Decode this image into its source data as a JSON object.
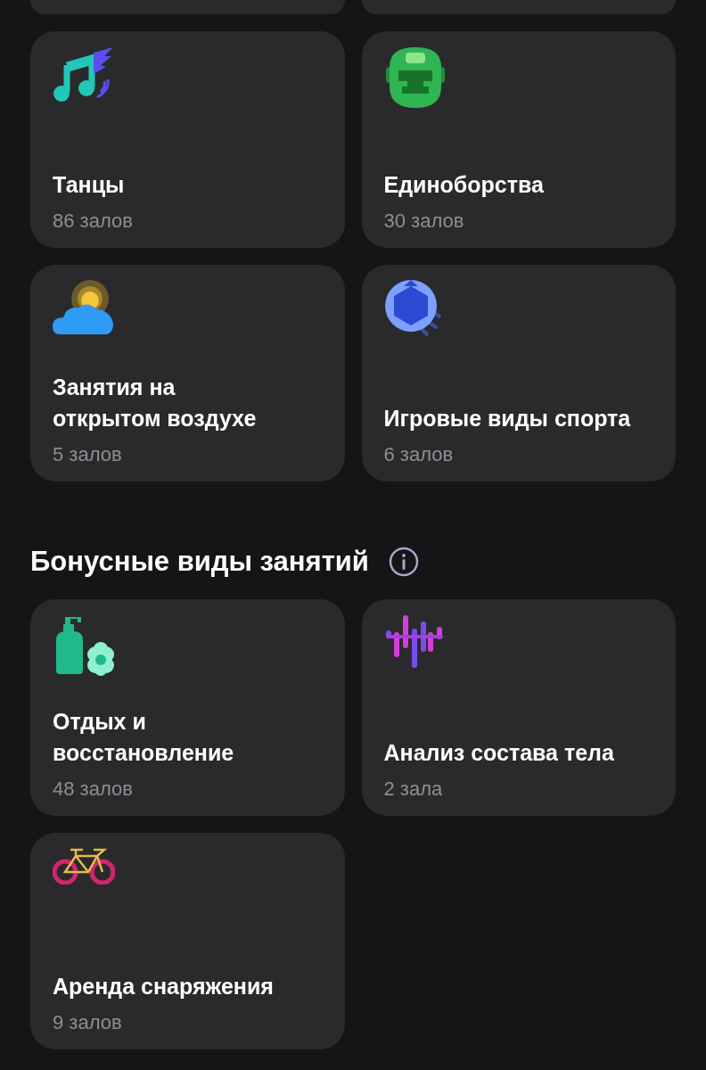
{
  "categories": [
    {
      "title": "Танцы",
      "count": "86 залов"
    },
    {
      "title": "Единоборства",
      "count": "30 залов"
    },
    {
      "title": "Занятия на\nоткрытом воздухе",
      "count": "5 залов"
    },
    {
      "title": "Игровые виды спорта",
      "count": "6 залов"
    }
  ],
  "bonus_section": {
    "title": "Бонусные виды занятий",
    "items": [
      {
        "title": "Отдых и\nвосстановление",
        "count": "48 залов"
      },
      {
        "title": "Анализ состава тела",
        "count": "2 зала"
      },
      {
        "title": "Аренда снаряжения",
        "count": "9 залов"
      }
    ]
  }
}
